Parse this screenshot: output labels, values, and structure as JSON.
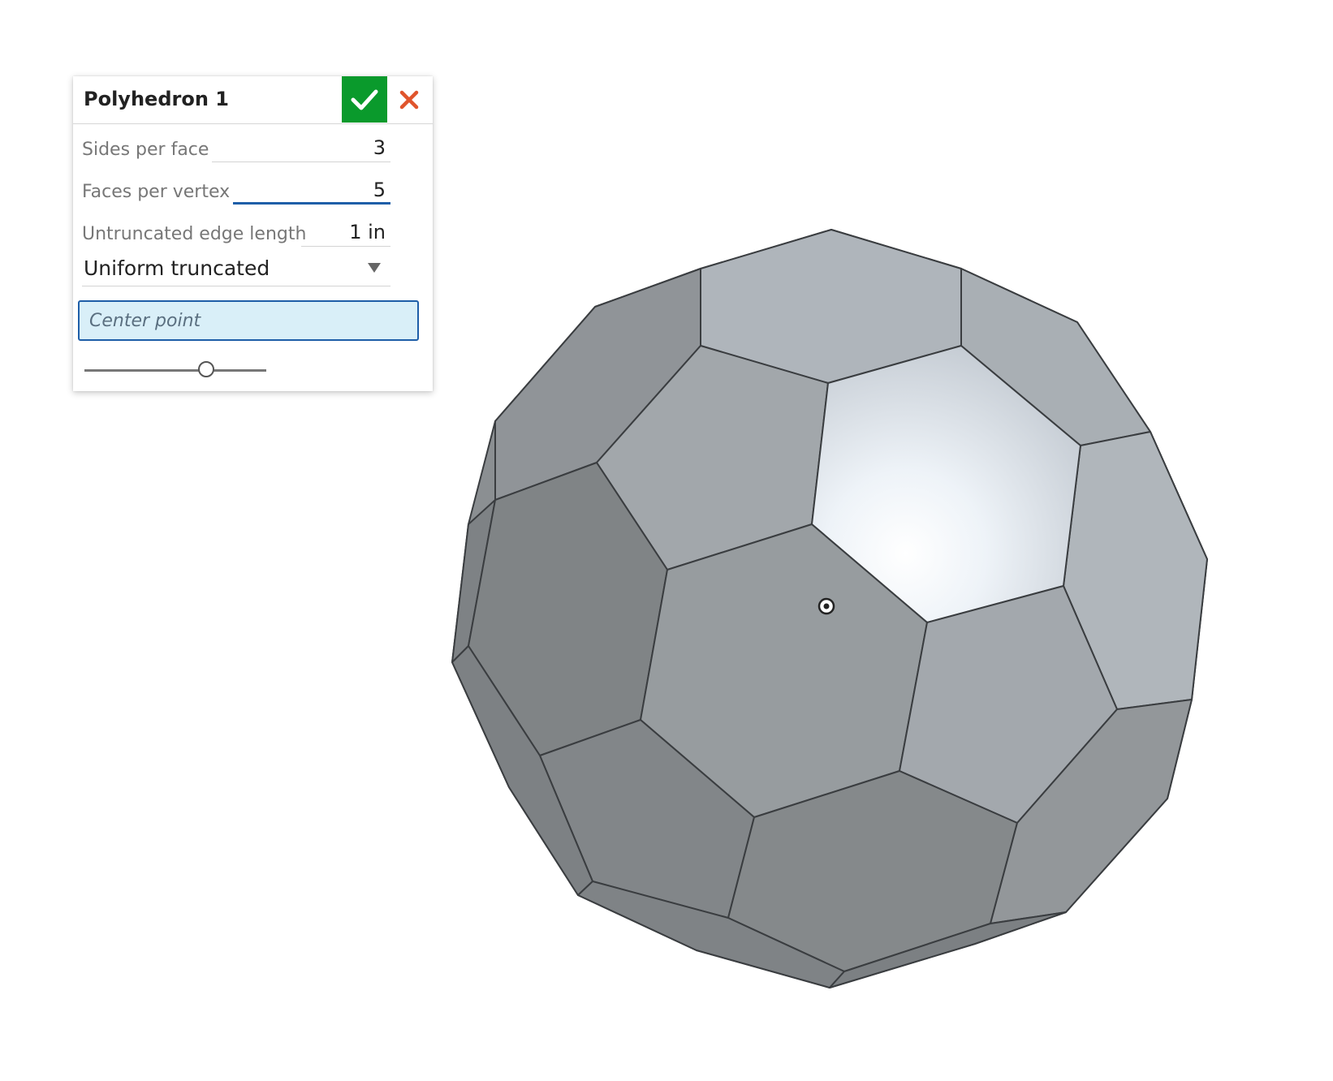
{
  "dialog": {
    "title": "Polyhedron 1",
    "ok_icon": "checkmark-icon",
    "cancel_icon": "close-icon",
    "fields": {
      "sides_per_face": {
        "label": "Sides per face",
        "value": "3"
      },
      "faces_per_vertex": {
        "label": "Faces per vertex",
        "value": "5"
      },
      "edge_length": {
        "label": "Untruncated edge length",
        "value": "1 in"
      }
    },
    "truncation": {
      "selected": "Uniform truncated",
      "icon": "caret-down-icon"
    },
    "center_point": {
      "placeholder": "Center point"
    },
    "slider": {
      "level": 0.67
    }
  },
  "viewport": {
    "model": "truncated icosahedron",
    "center_marker_icon": "origin-point-icon"
  }
}
